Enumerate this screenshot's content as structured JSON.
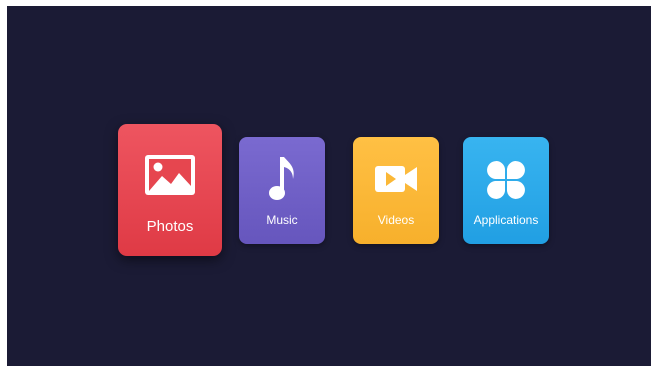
{
  "home_menu": {
    "items": [
      {
        "label": "Photos",
        "icon": "image-icon",
        "color": "#e6464f",
        "focused": true
      },
      {
        "label": "Music",
        "icon": "music-note-icon",
        "color": "#7060c8",
        "focused": false
      },
      {
        "label": "Videos",
        "icon": "video-camera-icon",
        "color": "#fbb836",
        "focused": false
      },
      {
        "label": "Applications",
        "icon": "apps-grid-icon",
        "color": "#2aa9ea",
        "focused": false
      }
    ]
  },
  "colors": {
    "background": "#1b1b35",
    "label_text": "#ffffff"
  }
}
